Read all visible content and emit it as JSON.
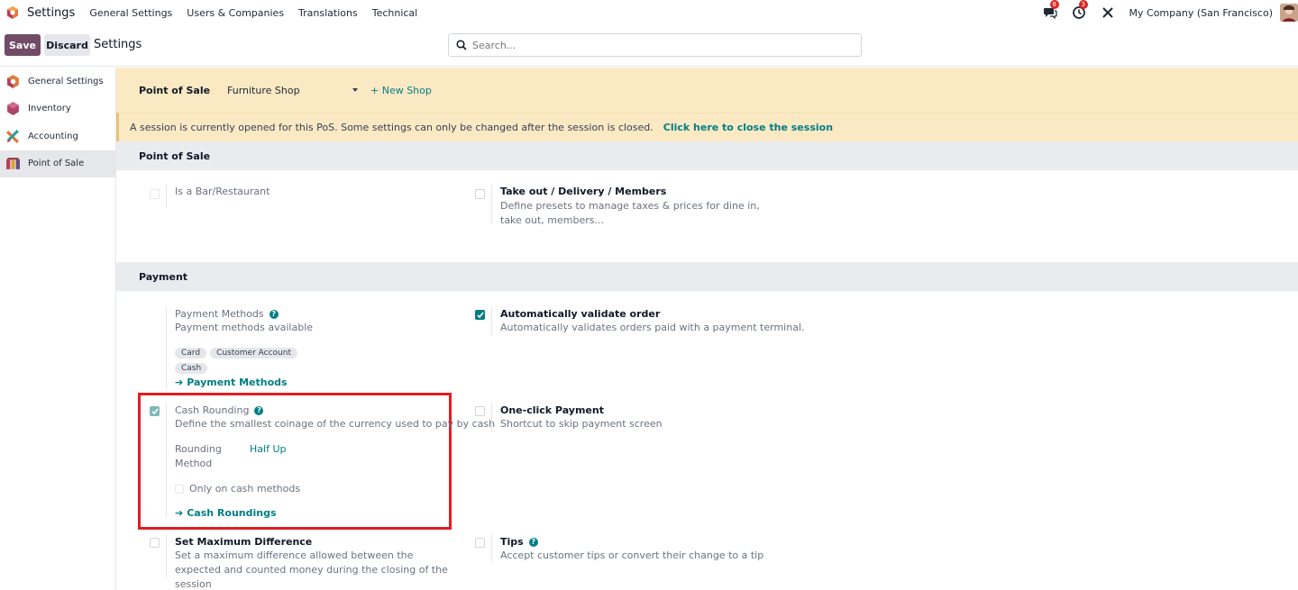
{
  "navbar": {
    "app_name": "Settings",
    "menus": [
      "General Settings",
      "Users & Companies",
      "Translations",
      "Technical"
    ],
    "messages_badge": "8",
    "activity_badge": "3",
    "company": "My Company (San Francisco)"
  },
  "control_panel": {
    "save_label": "Save",
    "discard_label": "Discard",
    "title": "Settings",
    "search_placeholder": "Search..."
  },
  "sidebar": {
    "items": [
      {
        "label": "General Settings",
        "icon": "odoo-logo-icon"
      },
      {
        "label": "Inventory",
        "icon": "inventory-icon"
      },
      {
        "label": "Accounting",
        "icon": "accounting-icon"
      },
      {
        "label": "Point of Sale",
        "icon": "point-of-sale-icon",
        "active": true
      }
    ]
  },
  "shop": {
    "label": "Point of Sale",
    "selected": "Furniture Shop",
    "new_shop": "+ New Shop",
    "session_notice": "A session is currently opened for this PoS. Some settings can only be changed after the session is closed.",
    "session_link": "Click here to close the session"
  },
  "pos_section": {
    "title": "Point of Sale",
    "bar_restaurant": {
      "title": "Is a Bar/Restaurant",
      "checked": false
    },
    "takeout": {
      "title": "Take out / Delivery / Members",
      "desc": "Define presets to manage taxes & prices for dine in, take out, members...",
      "checked": false
    }
  },
  "payment_section": {
    "title": "Payment",
    "payment_methods": {
      "title": "Payment Methods",
      "desc": "Payment methods available",
      "tags": [
        "Card",
        "Customer Account",
        "Cash"
      ],
      "link": "Payment Methods"
    },
    "auto_validate": {
      "title": "Automatically validate order",
      "desc": "Automatically validates orders paid with a payment terminal.",
      "checked": true
    },
    "cash_rounding": {
      "title": "Cash Rounding",
      "desc": "Define the smallest coinage of the currency used to pay by cash",
      "checked": true,
      "method_label_1": "Rounding",
      "method_label_2": "Method",
      "method_value": "Half Up",
      "only_cash": "Only on cash methods",
      "link": "Cash Roundings"
    },
    "one_click": {
      "title": "One-click Payment",
      "desc": "Shortcut to skip payment screen",
      "checked": false
    },
    "max_diff": {
      "title": "Set Maximum Difference",
      "desc": "Set a maximum difference allowed between the expected and counted money during the closing of the session",
      "checked": false
    },
    "tips": {
      "title": "Tips",
      "desc": "Accept customer tips or convert their change to a tip",
      "checked": false
    }
  },
  "colors": {
    "primary": "#714b67",
    "accent": "#017e84",
    "highlight": "#e11d23",
    "notice_bg": "#fbe9c4"
  }
}
